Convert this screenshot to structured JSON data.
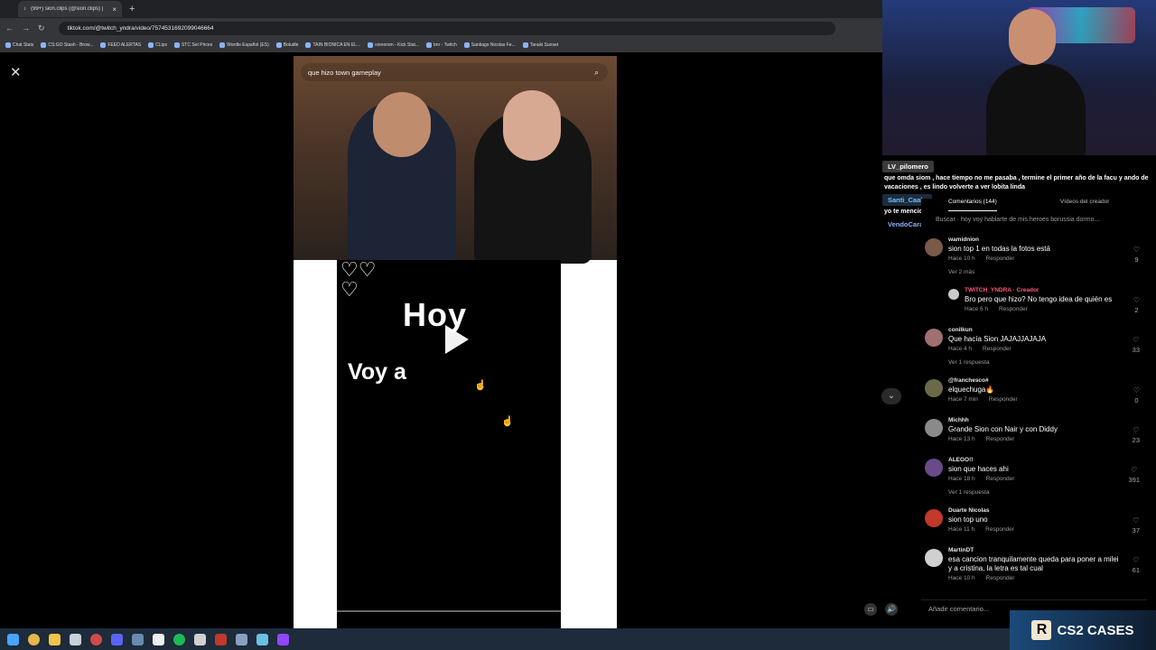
{
  "browser": {
    "tab_title": "(99+) sion.clips (@sion.clips) | TikTok",
    "url": "tiktok.com/@twitch_yndra/video/7574531692099046664",
    "bookmarks": [
      "Chat Stats",
      "CS:GO Stash - Brow...",
      "FEED ALERTAS",
      "CLips",
      "STC Set Prices",
      "Wordle Español (ES)",
      "Boludle",
      "TAIN BIONICA EN EL...",
      "sionerom - Kick Stat...",
      "tmr - Twitch",
      "Santiago Nicolas Fe...",
      "Tanuki Sunset"
    ]
  },
  "video": {
    "search_query": "que hizo town gameplay",
    "overlay_word_1": "Hoy",
    "overlay_word_2": "Voy a"
  },
  "chat": [
    {
      "user": "LV_pilomero",
      "user_color": "#ffffff",
      "user_bg": "#3b3b3b",
      "message": "que omda siom , hace tiempo no me pasaba , termine el primer año de la facu y ando de vacaciones , es lindo volverte a ver lobita linda"
    },
    {
      "user": "Santi_Caala",
      "user_color": "#6bc2ff",
      "user_bg": "#1c2b3c",
      "message": "yo te menciones"
    },
    {
      "user": "VendoCaramelo",
      "user_color": "#8ab4ff",
      "user_bg": "transparent",
      "message": ""
    }
  ],
  "comments_panel": {
    "tab_comments": "Comentarios (144)",
    "tab_creator_videos": "Vídeos del creador",
    "search_hint": "Buscar · hoy voy hablarte de mis heroes borussia dormo...",
    "reply_label": "Responder",
    "add_comment_placeholder": "Añadir comentario...",
    "comments": [
      {
        "name": "wamidnion",
        "text": "sion top 1 en todas la fotos está",
        "time": "Hace 10 h",
        "likes": "9",
        "avatar_color": "#7a5a4a"
      },
      {
        "name": "TWITCH_YNDRA · Creador",
        "text": "Bro pero que hizo? No tengo idea de quién es",
        "time": "Hace 6 h",
        "likes": "2",
        "avatar_color": "#c9c9c9",
        "is_reply": true
      },
      {
        "name": "conilkun",
        "text": "Que hacía Sion JAJAJJAJAJA",
        "time": "Hace 4 h",
        "likes": "33",
        "avatar_color": "#a07070"
      },
      {
        "name": "@franchesco#",
        "text": "elquechuga🔥",
        "time": "Hace 7 min",
        "likes": "0",
        "avatar_color": "#6a6a4a"
      },
      {
        "name": "Michhh",
        "text": "Grande Sion con Nair y con Diddy",
        "time": "Hace 13 h",
        "likes": "23",
        "avatar_color": "#8a8a8a"
      },
      {
        "name": "ALEGO!!",
        "text": "sion que haces ahi",
        "time": "Hace 18 h",
        "likes": "391",
        "avatar_color": "#6a4a8a"
      },
      {
        "name": "Duarte Nicolas",
        "text": "sion top uno",
        "time": "Hace 11 h",
        "likes": "37",
        "avatar_color": "#c0392b"
      },
      {
        "name": "MartinDT",
        "text": "esa cancion tranquilamente queda para poner a milei y a cristina, la letra es tal cual",
        "time": "Hace 10 h",
        "likes": "61",
        "avatar_color": "#d0d0d0"
      }
    ],
    "see_more_1": "Ver 2 más",
    "see_reply_1": "Ver 1 respuesta",
    "see_reply_2": "Ver 1 respuesta"
  },
  "overlay_brand": {
    "logo_letter": "R",
    "text": "CS2 CASES"
  }
}
